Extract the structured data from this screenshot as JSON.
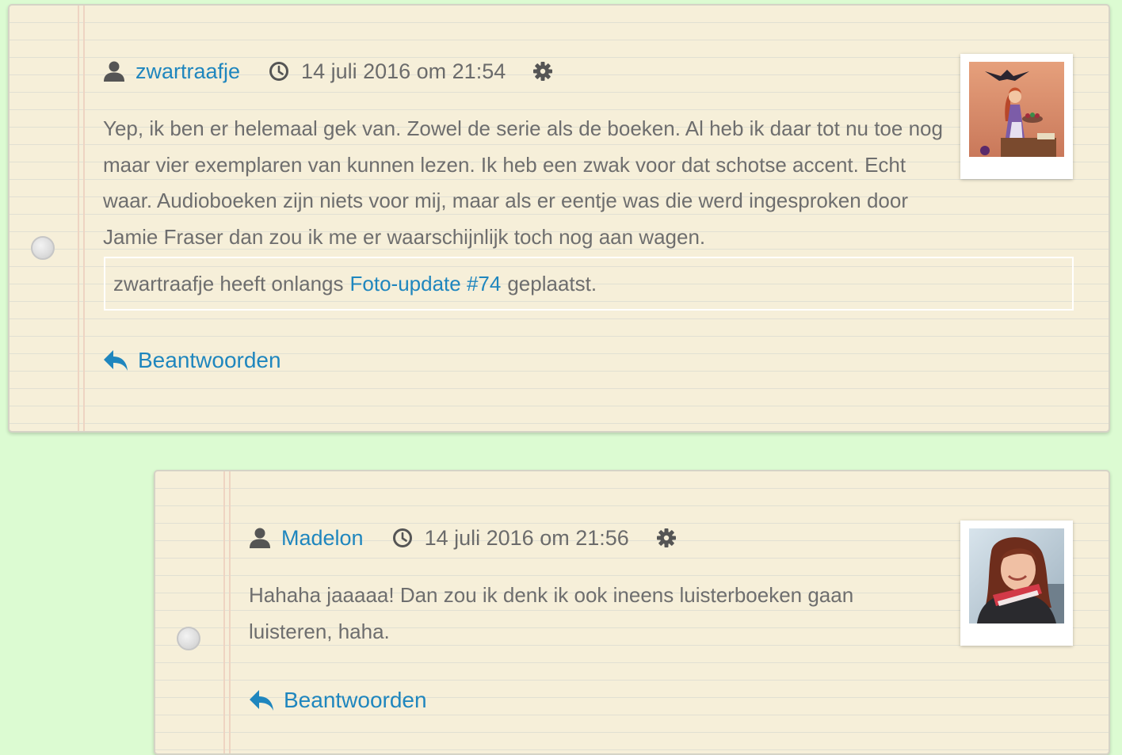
{
  "comments": [
    {
      "author": "zwartraafje",
      "date": "14 juli 2016 om 21:54",
      "text": "Yep, ik ben er helemaal gek van. Zowel de serie als de boeken. Al heb ik daar tot nu toe nog maar vier exemplaren van kunnen lezen. Ik heb een zwak voor dat schotse accent. Echt waar. Audioboeken zijn niets voor mij, maar als er eentje was die werd ingesproken door Jamie Fraser dan zou ik me er waarschijnlijk toch nog aan wagen.",
      "update": {
        "prefix": "zwartraafje heeft onlangs",
        "link": "Foto-update #74",
        "suffix": "geplaatst."
      },
      "reply_label": "Beantwoorden"
    },
    {
      "author": "Madelon",
      "date": "14 juli 2016 om 21:56",
      "text": "Hahaha jaaaaa! Dan zou ik denk ik ook ineens luisterboeken gaan luisteren, haha.",
      "reply_label": "Beantwoorden"
    }
  ],
  "icons": {
    "user": "user-icon",
    "clock": "clock-icon",
    "settings": "gear-icon",
    "reply": "reply-arrow-icon"
  },
  "colors": {
    "background": "#dcfbd2",
    "card": "#f6efd9",
    "link": "#1f86be",
    "text": "#6e6e6e"
  }
}
